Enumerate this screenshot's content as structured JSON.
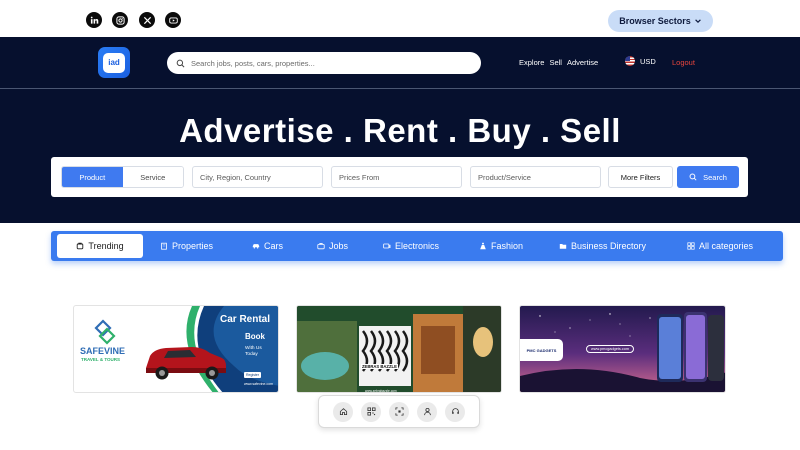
{
  "topbar": {
    "socials": [
      {
        "name": "linkedin-icon",
        "glyph": "in"
      },
      {
        "name": "instagram-icon",
        "glyph": "ig"
      },
      {
        "name": "x-icon",
        "glyph": "x"
      },
      {
        "name": "youtube-icon",
        "glyph": "yt"
      }
    ],
    "sectors_label": "Browser Sectors"
  },
  "header": {
    "logo_text": "iad",
    "search_placeholder": "Search jobs, posts, cars, properties...",
    "nav": [
      "Explore",
      "Sell",
      "Advertise"
    ],
    "currency": "USD",
    "logout": "Logout"
  },
  "hero": {
    "headline": "Advertise . Rent . Buy . Sell"
  },
  "filters": {
    "tabs": [
      "Product",
      "Service"
    ],
    "active_tab": "Product",
    "location_placeholder": "City, Region, Country",
    "price_placeholder": "Prices From",
    "item_placeholder": "Product/Service",
    "more_label": "More Filters",
    "search_label": "Search"
  },
  "categories": [
    {
      "label": "Trending",
      "icon": "trending-icon",
      "active": true
    },
    {
      "label": "Properties",
      "icon": "building-icon",
      "active": false
    },
    {
      "label": "Cars",
      "icon": "car-icon",
      "active": false
    },
    {
      "label": "Jobs",
      "icon": "briefcase-icon",
      "active": false
    },
    {
      "label": "Electronics",
      "icon": "electronics-icon",
      "active": false
    },
    {
      "label": "Fashion",
      "icon": "fashion-icon",
      "active": false
    },
    {
      "label": "Business Directory",
      "icon": "folder-icon",
      "active": false
    },
    {
      "label": "All categories",
      "icon": "grid-icon",
      "active": false
    }
  ],
  "banners": {
    "b1": {
      "brand": "SAFEVINE",
      "brand_sub": "TRAVEL & TOURS",
      "title": "Car Rental",
      "cta": "Book",
      "line": "With Us Today",
      "btn": "Register",
      "url": "www.safevine.com"
    },
    "b2": {
      "caption": "ZEBRAS BAZZLE",
      "url": "www.zebrabazzle.com"
    },
    "b3": {
      "brand": "PMC GADGETS",
      "url": "www.pmcgadgets.com"
    }
  },
  "dock": [
    {
      "name": "home-icon"
    },
    {
      "name": "qr-code-icon"
    },
    {
      "name": "scan-icon"
    },
    {
      "name": "user-icon"
    },
    {
      "name": "support-icon"
    }
  ],
  "colors": {
    "hero_bg": "#06102e",
    "accent": "#3a7bef",
    "logout": "#e8453c",
    "sectors_bg": "#c9dcf7"
  }
}
